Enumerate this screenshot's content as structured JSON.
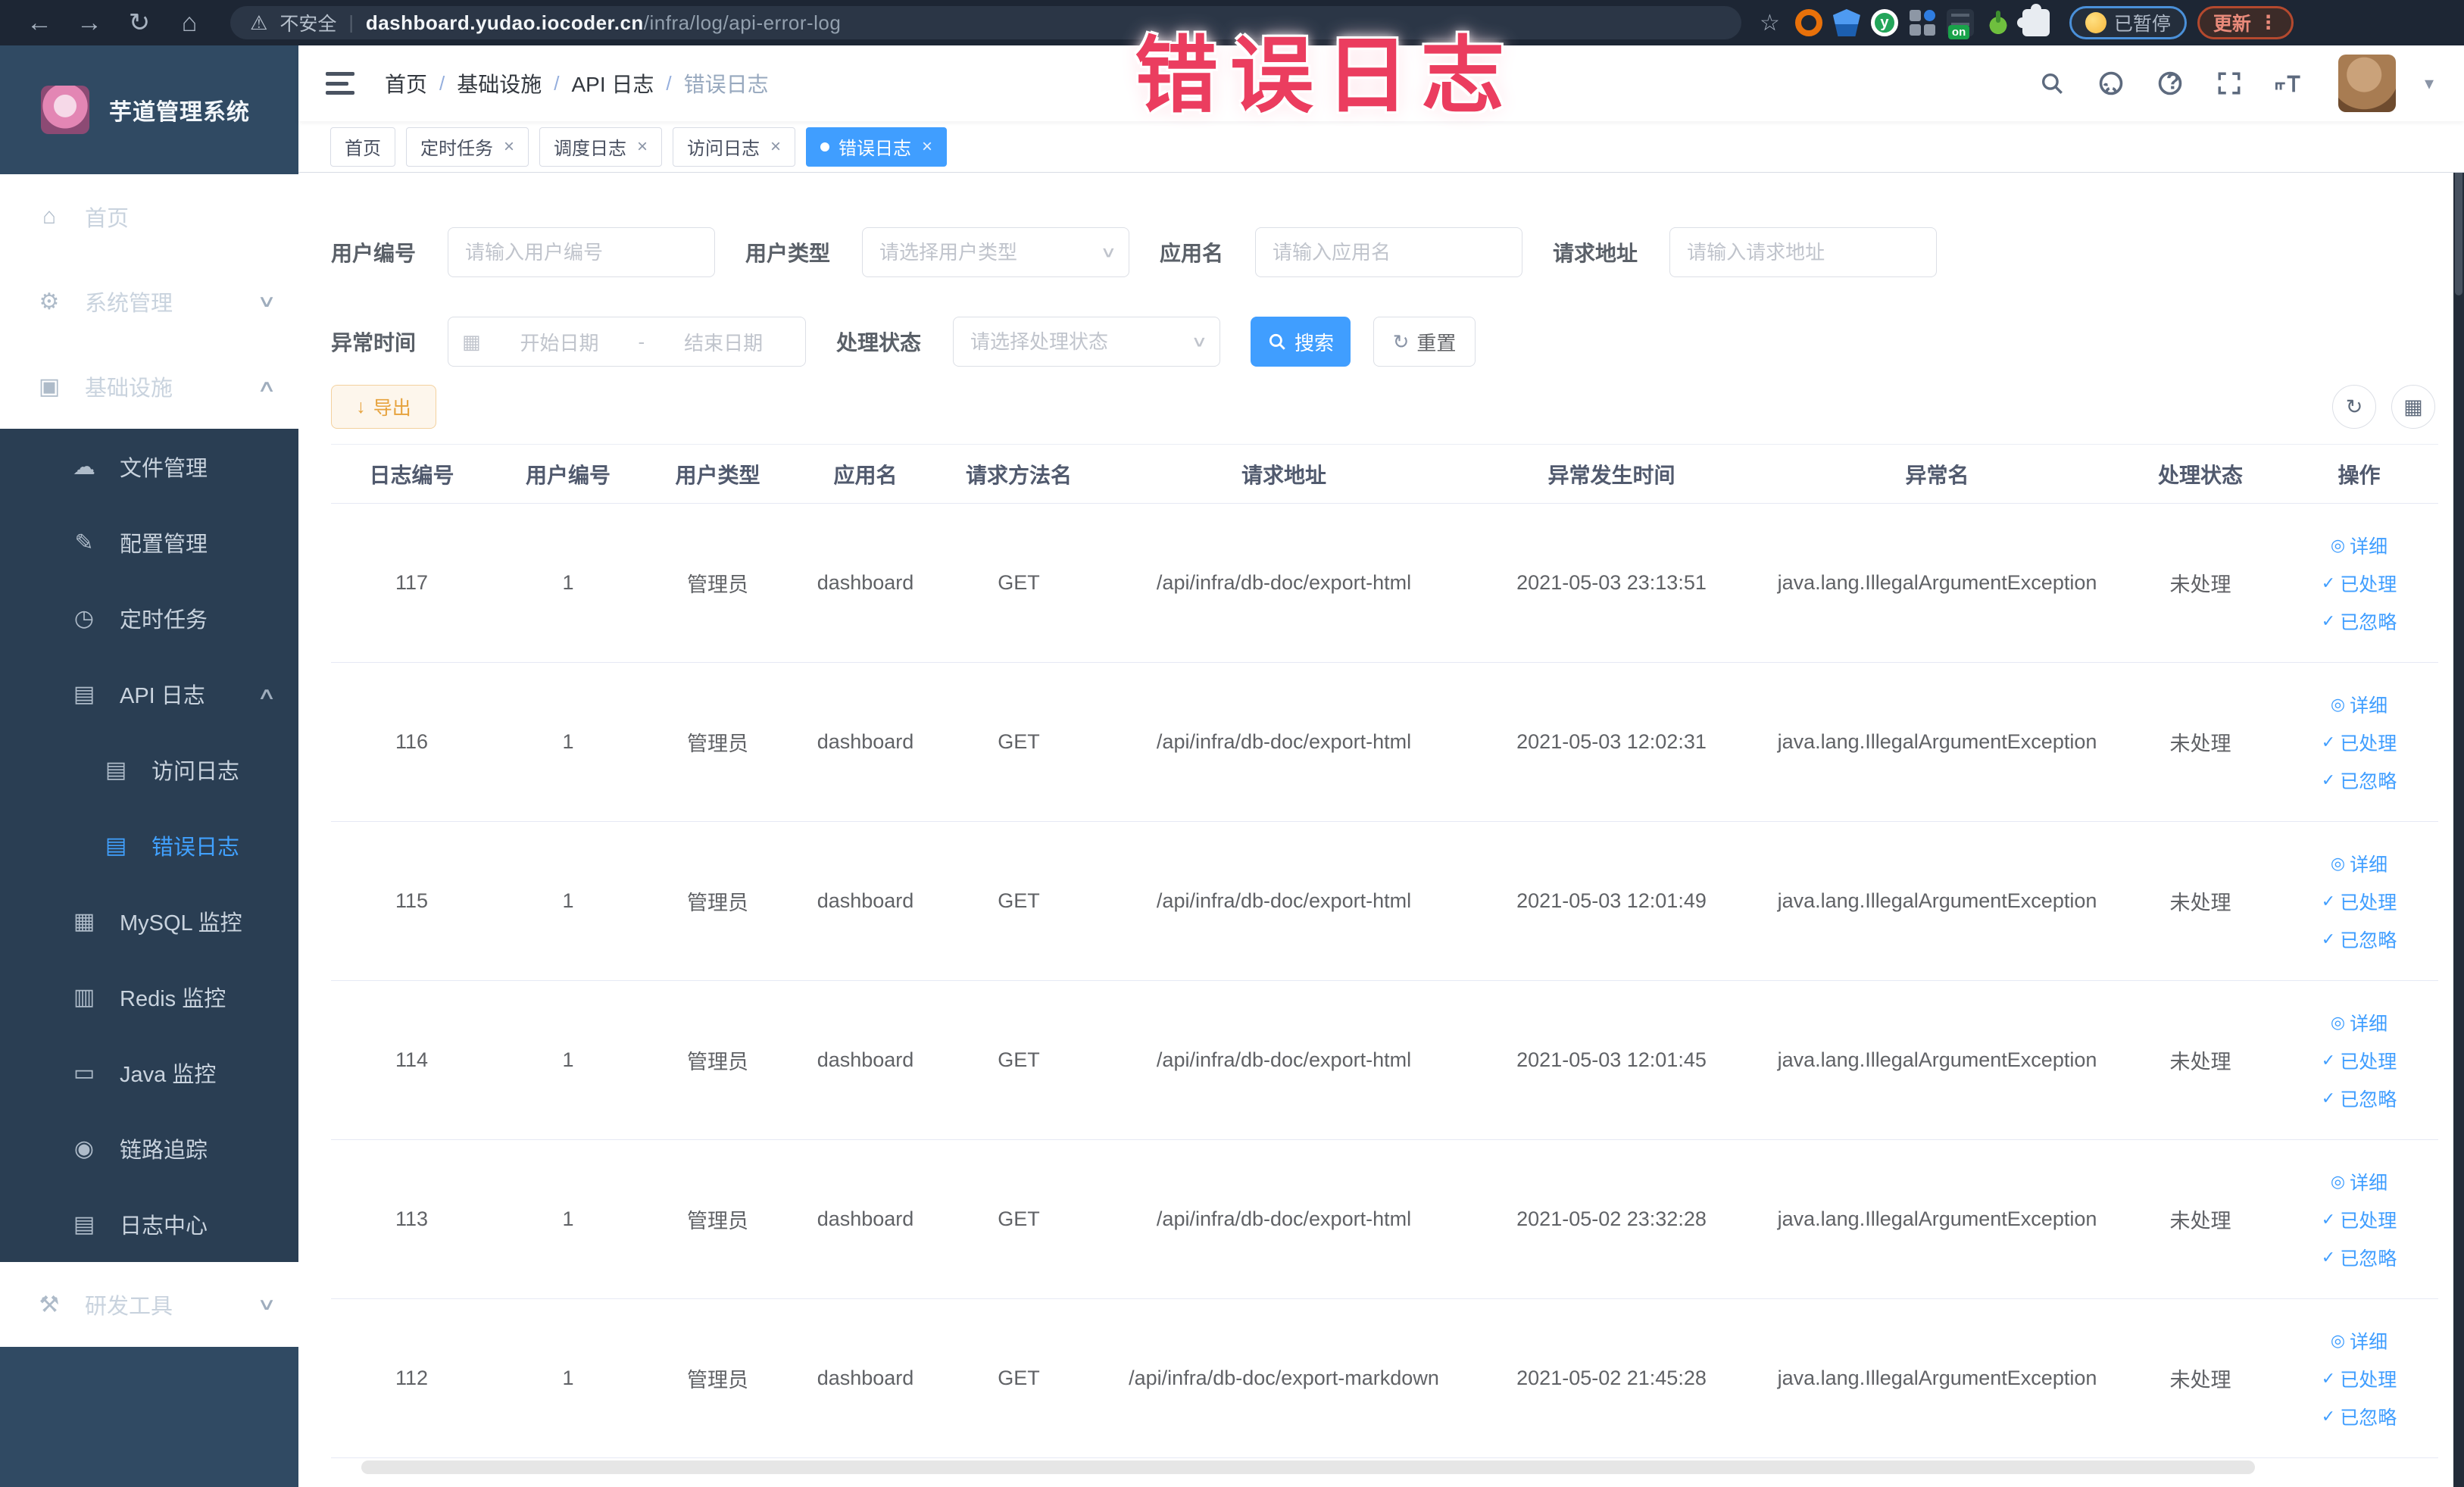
{
  "browser": {
    "insecure_label": "不安全",
    "url_domain": "dashboard.yudao.iocoder.cn",
    "url_path": "/infra/log/api-error-log",
    "ext_on_label": "on",
    "paused_pill_label": "已暂停",
    "update_pill_label": "更新"
  },
  "overlay": {
    "title": "错误日志",
    "color": "#eb3d5f"
  },
  "sidebar": {
    "app_title": "芋道管理系统",
    "sections": [
      {
        "type": "main",
        "items": [
          {
            "id": "home",
            "label": "首页",
            "icon": "home-icon",
            "glyph": "⌂",
            "level": 1
          },
          {
            "id": "system",
            "label": "系统管理",
            "icon": "gear-icon",
            "glyph": "⚙",
            "level": 1,
            "chevron": "down"
          },
          {
            "id": "infra",
            "label": "基础设施",
            "icon": "monitor-icon",
            "glyph": "▣",
            "level": 1,
            "chevron": "up"
          }
        ]
      },
      {
        "type": "sub",
        "items": [
          {
            "id": "file",
            "label": "文件管理",
            "icon": "cloud-icon",
            "glyph": "☁",
            "level": 2
          },
          {
            "id": "config",
            "label": "配置管理",
            "icon": "edit-icon",
            "glyph": "✎",
            "level": 2
          },
          {
            "id": "job",
            "label": "定时任务",
            "icon": "clock-icon",
            "glyph": "◷",
            "level": 2
          },
          {
            "id": "api-log",
            "label": "API 日志",
            "icon": "api-log-icon",
            "glyph": "▤",
            "level": 2,
            "chevron": "up"
          },
          {
            "id": "access-log",
            "label": "访问日志",
            "icon": "access-log-icon",
            "glyph": "▤",
            "level": 3
          },
          {
            "id": "error-log",
            "label": "错误日志",
            "icon": "error-log-icon",
            "glyph": "▤",
            "level": 3,
            "active": true
          },
          {
            "id": "mysql",
            "label": "MySQL 监控",
            "icon": "mysql-icon",
            "glyph": "▦",
            "level": 2
          },
          {
            "id": "redis",
            "label": "Redis 监控",
            "icon": "redis-icon",
            "glyph": "▥",
            "level": 2
          },
          {
            "id": "java",
            "label": "Java 监控",
            "icon": "java-icon",
            "glyph": "▭",
            "level": 2
          },
          {
            "id": "trace",
            "label": "链路追踪",
            "icon": "trace-icon",
            "glyph": "◉",
            "level": 2
          },
          {
            "id": "log-center",
            "label": "日志中心",
            "icon": "log-center-icon",
            "glyph": "▤",
            "level": 2
          }
        ]
      },
      {
        "type": "main",
        "items": [
          {
            "id": "devtools",
            "label": "研发工具",
            "icon": "tools-icon",
            "glyph": "⚒",
            "level": 1,
            "chevron": "down"
          }
        ]
      }
    ]
  },
  "header": {
    "breadcrumbs": [
      "首页",
      "基础设施",
      "API 日志",
      "错误日志"
    ],
    "separator": "/"
  },
  "tabs": [
    {
      "label": "首页",
      "closable": false,
      "active": false
    },
    {
      "label": "定时任务",
      "closable": true,
      "active": false
    },
    {
      "label": "调度日志",
      "closable": true,
      "active": false
    },
    {
      "label": "访问日志",
      "closable": true,
      "active": false
    },
    {
      "label": "错误日志",
      "closable": true,
      "active": true
    }
  ],
  "filters": {
    "user_id": {
      "label": "用户编号",
      "placeholder": "请输入用户编号"
    },
    "user_type": {
      "label": "用户类型",
      "placeholder": "请选择用户类型"
    },
    "app_name": {
      "label": "应用名",
      "placeholder": "请输入应用名"
    },
    "request_url": {
      "label": "请求地址",
      "placeholder": "请输入请求地址"
    },
    "exception_time": {
      "label": "异常时间",
      "start_placeholder": "开始日期",
      "separator": "-",
      "end_placeholder": "结束日期"
    },
    "process_status": {
      "label": "处理状态",
      "placeholder": "请选择处理状态"
    },
    "search_label": "搜索",
    "reset_label": "重置"
  },
  "toolbar": {
    "export_label": "导出"
  },
  "table": {
    "columns": [
      {
        "key": "id",
        "label": "日志编号"
      },
      {
        "key": "user_id",
        "label": "用户编号"
      },
      {
        "key": "user_type",
        "label": "用户类型"
      },
      {
        "key": "app",
        "label": "应用名"
      },
      {
        "key": "method",
        "label": "请求方法名"
      },
      {
        "key": "url",
        "label": "请求地址"
      },
      {
        "key": "time",
        "label": "异常发生时间"
      },
      {
        "key": "exception",
        "label": "异常名"
      },
      {
        "key": "status",
        "label": "处理状态"
      },
      {
        "key": "actions",
        "label": "操作"
      }
    ],
    "row_actions": [
      {
        "label": "详细",
        "icon": "eye-icon",
        "glyph": "◎"
      },
      {
        "label": "已处理",
        "icon": "check-icon",
        "glyph": "✓"
      },
      {
        "label": "已忽略",
        "icon": "check-icon",
        "glyph": "✓"
      }
    ],
    "rows": [
      {
        "id": "117",
        "user_id": "1",
        "user_type": "管理员",
        "app": "dashboard",
        "method": "GET",
        "url": "/api/infra/db-doc/export-html",
        "time": "2021-05-03 23:13:51",
        "exception": "java.lang.IllegalArgumentException",
        "status": "未处理"
      },
      {
        "id": "116",
        "user_id": "1",
        "user_type": "管理员",
        "app": "dashboard",
        "method": "GET",
        "url": "/api/infra/db-doc/export-html",
        "time": "2021-05-03 12:02:31",
        "exception": "java.lang.IllegalArgumentException",
        "status": "未处理"
      },
      {
        "id": "115",
        "user_id": "1",
        "user_type": "管理员",
        "app": "dashboard",
        "method": "GET",
        "url": "/api/infra/db-doc/export-html",
        "time": "2021-05-03 12:01:49",
        "exception": "java.lang.IllegalArgumentException",
        "status": "未处理"
      },
      {
        "id": "114",
        "user_id": "1",
        "user_type": "管理员",
        "app": "dashboard",
        "method": "GET",
        "url": "/api/infra/db-doc/export-html",
        "time": "2021-05-03 12:01:45",
        "exception": "java.lang.IllegalArgumentException",
        "status": "未处理"
      },
      {
        "id": "113",
        "user_id": "1",
        "user_type": "管理员",
        "app": "dashboard",
        "method": "GET",
        "url": "/api/infra/db-doc/export-html",
        "time": "2021-05-02 23:32:28",
        "exception": "java.lang.IllegalArgumentException",
        "status": "未处理"
      },
      {
        "id": "112",
        "user_id": "1",
        "user_type": "管理员",
        "app": "dashboard",
        "method": "GET",
        "url": "/api/infra/db-doc/export-markdown",
        "time": "2021-05-02 21:45:28",
        "exception": "java.lang.IllegalArgumentException",
        "status": "未处理"
      }
    ]
  },
  "colors": {
    "accent": "#409EFF",
    "warning": "#e6a23c",
    "chrome_bg": "#1d2634",
    "sidebar_bg": "#304a63",
    "submenu_bg": "#2a3e53",
    "overlay_red": "#eb3d5f"
  }
}
